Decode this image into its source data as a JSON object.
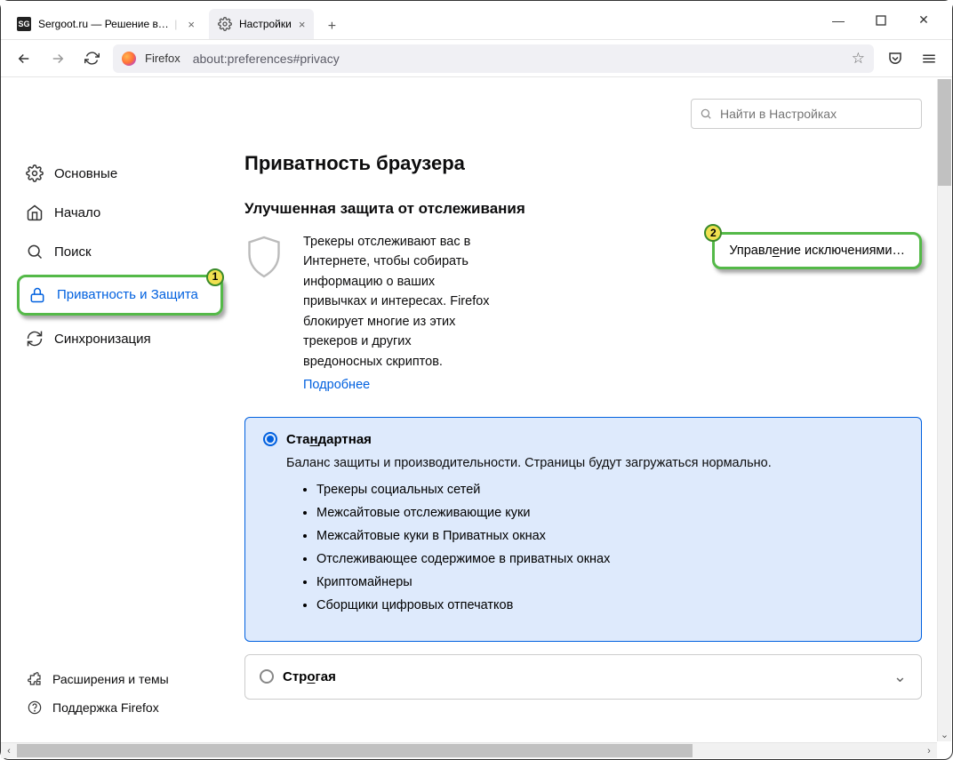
{
  "window": {
    "tabs": [
      {
        "label": "Sergoot.ru — Решение ваших",
        "favicon": "SG",
        "close": "×"
      },
      {
        "label": "Настройки",
        "favicon": "gear",
        "close": "×"
      }
    ],
    "new_tab": "+",
    "controls": {
      "min": "—",
      "max": "▢",
      "close": "✕"
    }
  },
  "navbar": {
    "back": "←",
    "forward": "→",
    "reload": "↻",
    "identity_label": "Firefox",
    "url": "about:preferences#privacy",
    "star": "☆",
    "pocket": "⌄",
    "menu": "≡"
  },
  "search": {
    "placeholder": "Найти в Настройках"
  },
  "sidebar": {
    "items": [
      {
        "label": "Основные",
        "icon": "gear"
      },
      {
        "label": "Начало",
        "icon": "home"
      },
      {
        "label": "Поиск",
        "icon": "search"
      },
      {
        "label": "Приватность и Защита",
        "icon": "lock",
        "active": true
      },
      {
        "label": "Синхронизация",
        "icon": "sync"
      }
    ],
    "footer": [
      {
        "label": "Расширения и темы",
        "icon": "puzzle"
      },
      {
        "label": "Поддержка Firefox",
        "icon": "help"
      }
    ]
  },
  "page": {
    "title": "Приватность браузера",
    "tracking": {
      "heading": "Улучшенная защита от отслеживания",
      "body": "Трекеры отслеживают вас в Интернете, чтобы собирать информацию о ваших привычках и интересах. Firefox блокирует многие из этих трекеров и других вредоносных скриптов.",
      "more": "Подробнее",
      "exceptions_btn": "Управление исключениями…"
    },
    "standard": {
      "title": "Стандартная",
      "desc": "Баланс защиты и производительности. Страницы будут загружаться нормально.",
      "items": [
        "Трекеры социальных сетей",
        "Межсайтовые отслеживающие куки",
        "Межсайтовые куки в Приватных окнах",
        "Отслеживающее содержимое в приватных окнах",
        "Криптомайнеры",
        "Сборщики цифровых отпечатков"
      ]
    },
    "strict": {
      "title": "Строгая"
    }
  },
  "annotations": {
    "one": "1",
    "two": "2"
  }
}
